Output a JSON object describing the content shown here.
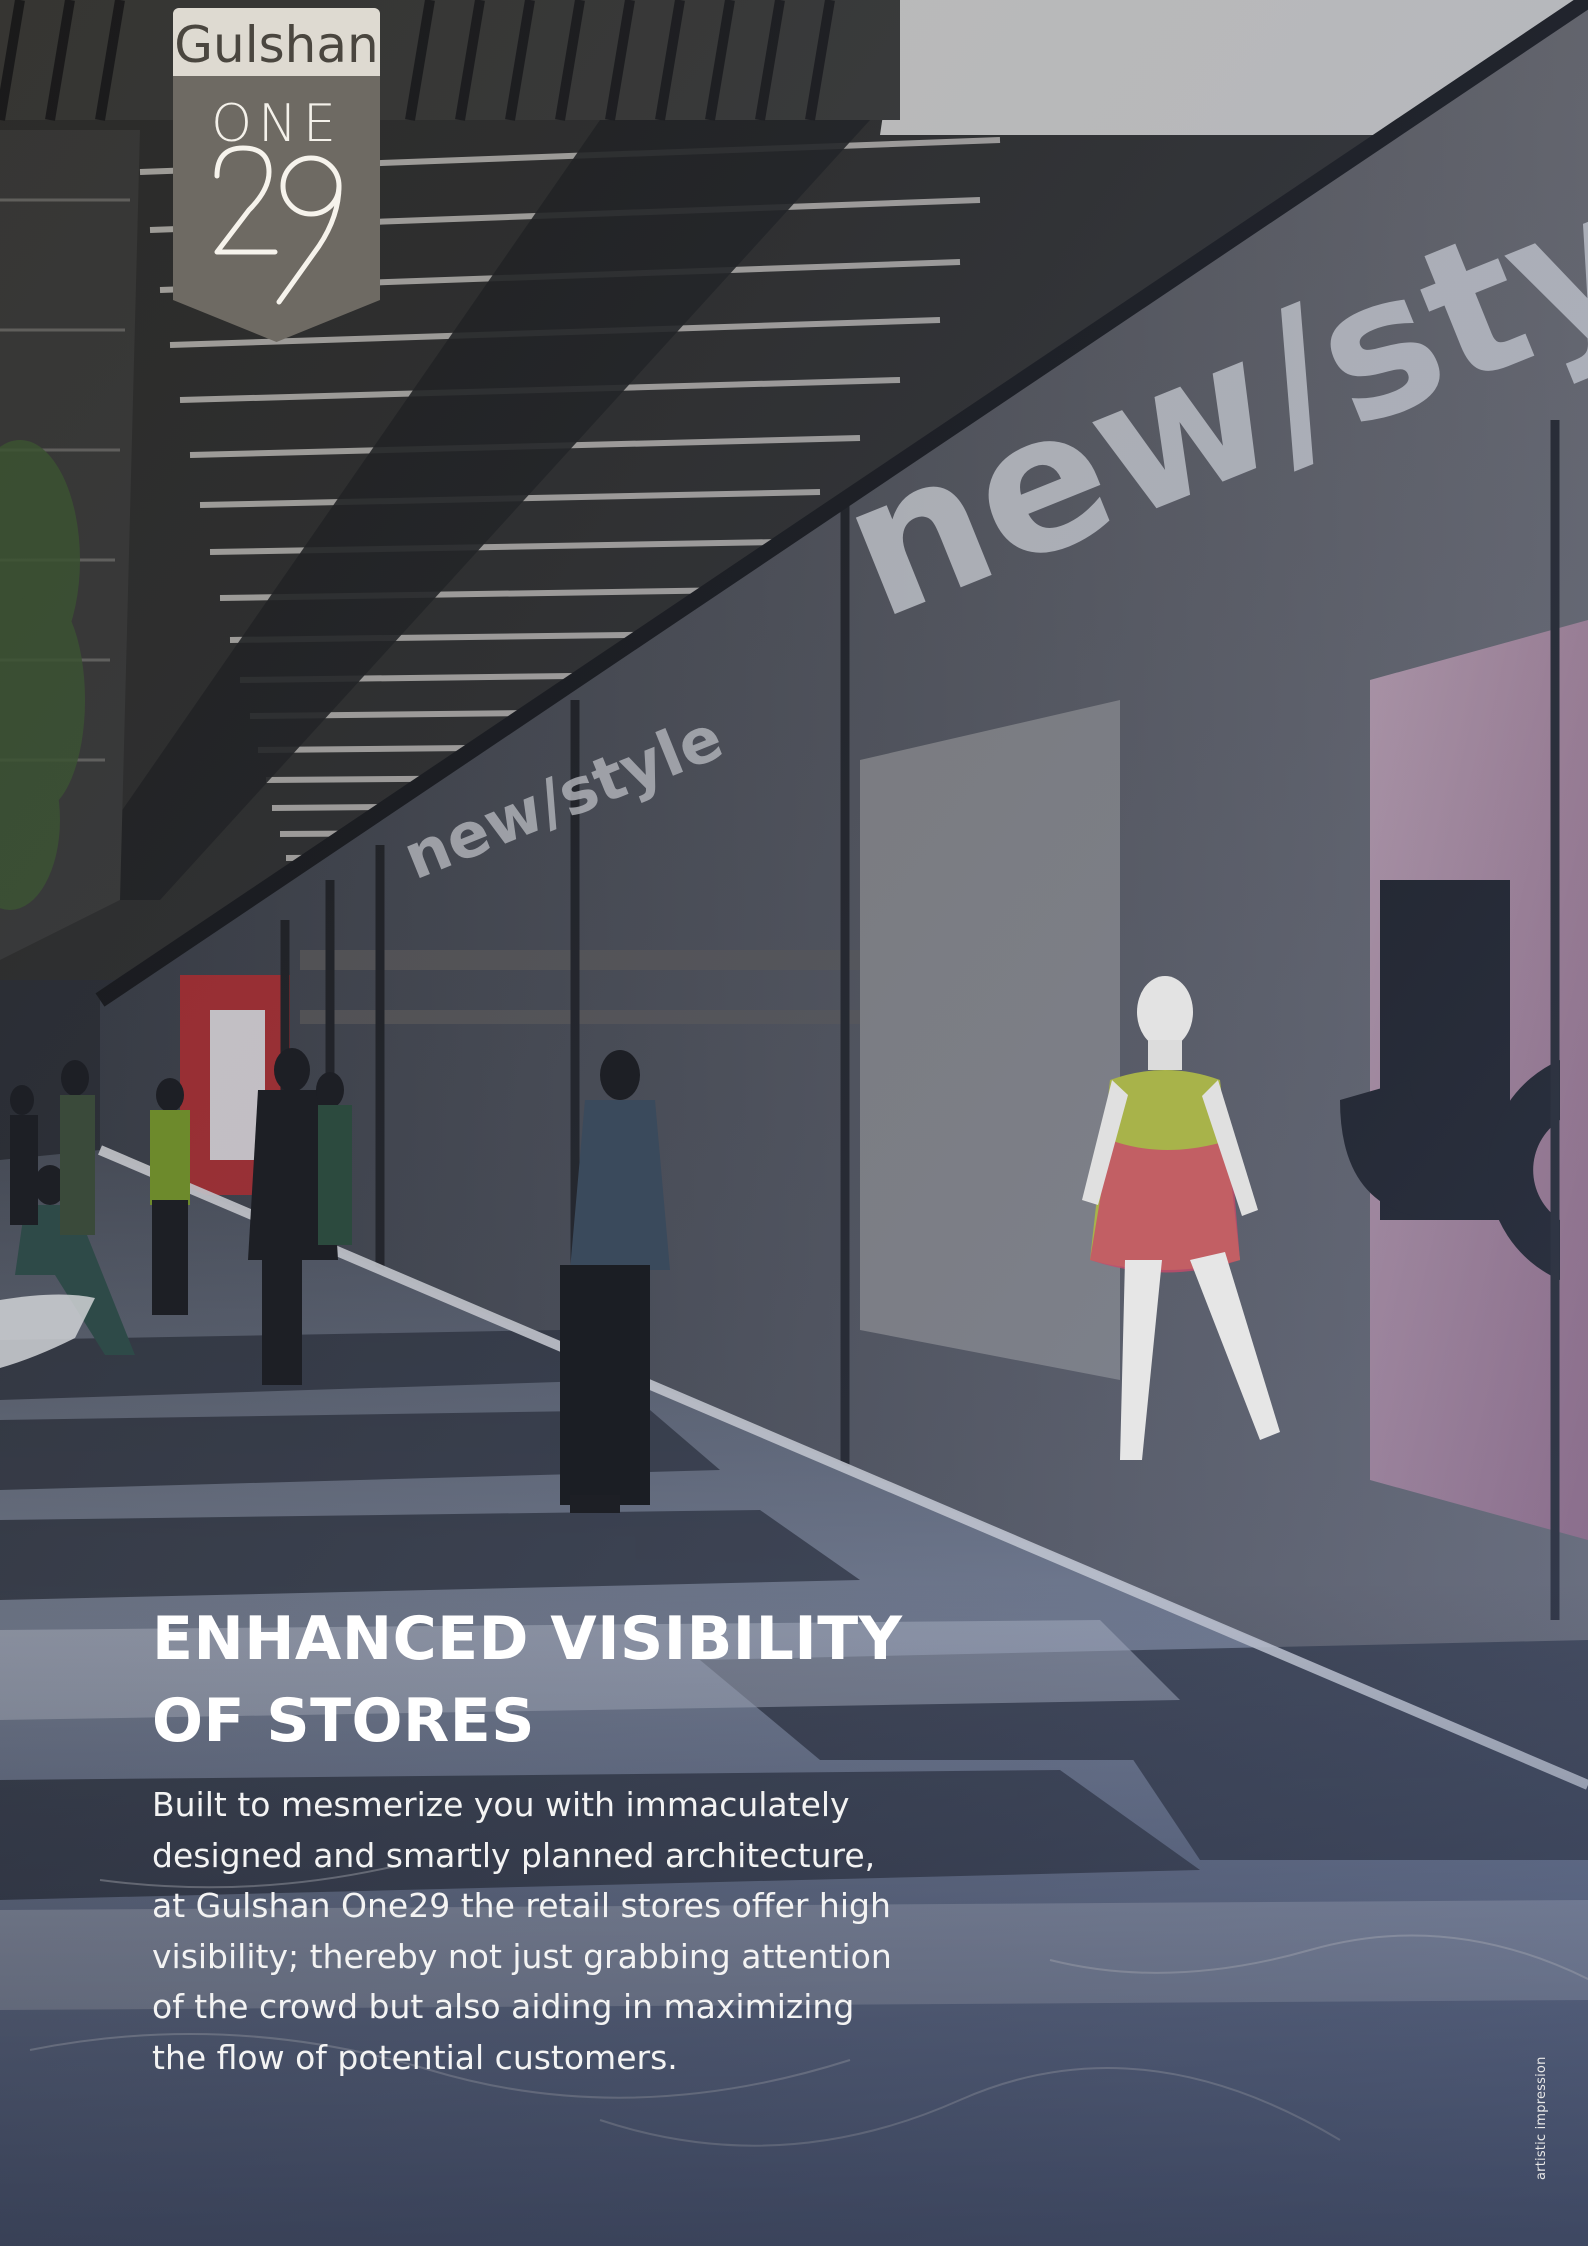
{
  "logo": {
    "wordmark": "Gulshan",
    "line1": "ONE",
    "line2": "29",
    "colors": {
      "wordmark_band": "#dedad1",
      "shield": "#6e6a63"
    }
  },
  "headline": {
    "line1": "ENHANCED VISIBILITY",
    "line2": "OF STORES"
  },
  "body": {
    "lines": [
      "Built to mesmerize you with immaculately",
      "designed and smartly planned architecture,",
      "at Gulshan One29 the retail stores offer high",
      "visibility; thereby not just grabbing attention",
      "of the crowd but also aiding in maximizing",
      "the flow of potential customers."
    ]
  },
  "storefront_signs": {
    "main": "new/sty",
    "secondary": "new/style",
    "window_letters": "JC"
  },
  "disclaimer": "artistic impression",
  "colors": {
    "ceiling": "#2b2a27",
    "ceiling_slats": "#c9c6bf",
    "floor": "#8a93a6",
    "headline": "#ffffff"
  }
}
